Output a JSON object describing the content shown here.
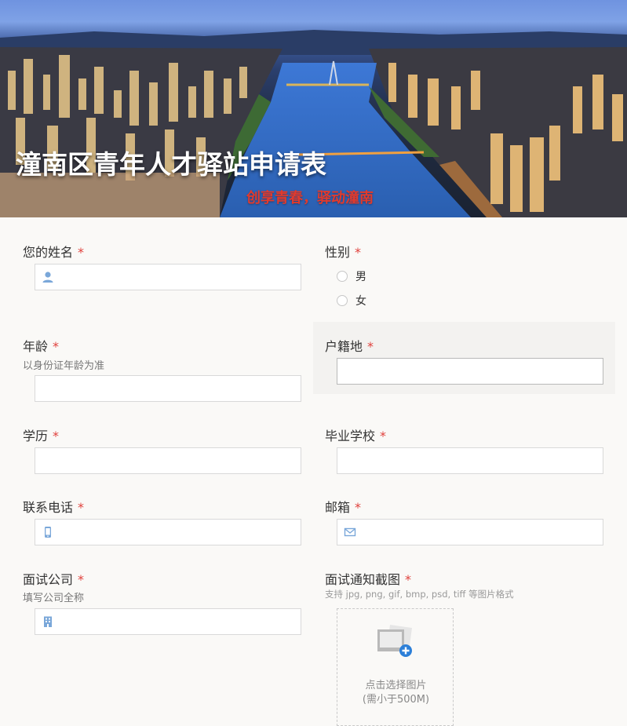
{
  "banner": {
    "title": "潼南区青年人才驿站申请表",
    "subtitle": "创享青春，驿动潼南"
  },
  "colors": {
    "required": "#e0413c",
    "subtitle": "#e23a2c",
    "icon": "#7aa7d9",
    "upload_plus": "#2c7fd8"
  },
  "form": {
    "required_mark": "*",
    "name": {
      "label": "您的姓名",
      "icon": "user-icon",
      "value": "",
      "placeholder": ""
    },
    "gender": {
      "label": "性别",
      "options": [
        "男",
        "女"
      ],
      "selected": null
    },
    "age": {
      "label": "年龄",
      "hint": "以身份证年龄为准",
      "value": "",
      "placeholder": ""
    },
    "hukou": {
      "label": "户籍地",
      "value": "",
      "placeholder": ""
    },
    "education": {
      "label": "学历",
      "value": "",
      "placeholder": ""
    },
    "school": {
      "label": "毕业学校",
      "value": "",
      "placeholder": ""
    },
    "phone": {
      "label": "联系电话",
      "icon": "mobile-phone-icon",
      "value": "",
      "placeholder": ""
    },
    "email": {
      "label": "邮箱",
      "icon": "envelope-icon",
      "value": "",
      "placeholder": ""
    },
    "company": {
      "label": "面试公司",
      "hint": "填写公司全称",
      "icon": "building-icon",
      "value": "",
      "placeholder": ""
    },
    "screenshot": {
      "label": "面试通知截图",
      "hint": "支持 jpg, png, gif, bmp, psd, tiff 等图片格式",
      "upload_text": "点击选择图片",
      "upload_limit": "(需小于500M)",
      "icon": "add-image-icon"
    }
  }
}
